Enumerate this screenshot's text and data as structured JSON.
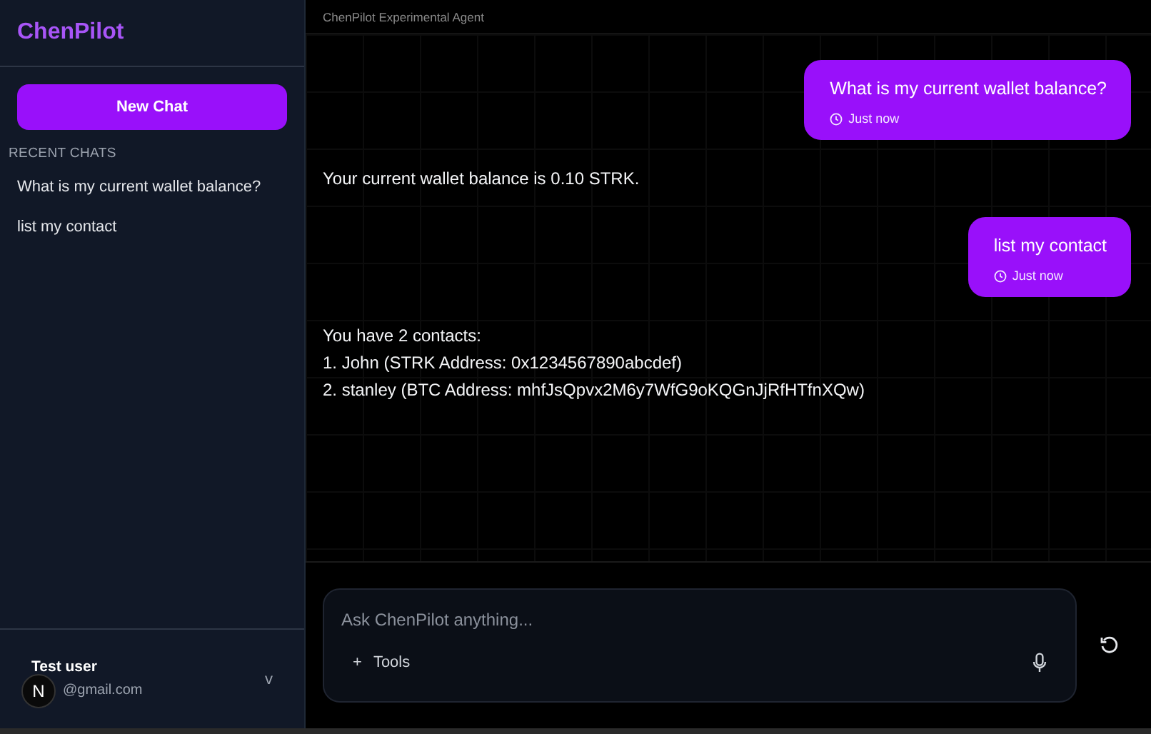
{
  "sidebar": {
    "brand": "ChenPilot",
    "new_chat_button": "New Chat",
    "recent_heading": "RECENT CHATS",
    "recent_chats": [
      {
        "title": "What is my current wallet balance?"
      },
      {
        "title": "list my contact"
      }
    ],
    "user": {
      "name": "Test user",
      "email": "@gmail.com",
      "menu_toggle": "v"
    },
    "floating_badge": "N"
  },
  "header": {
    "title": "ChenPilot Experimental Agent"
  },
  "messages": [
    {
      "kind": "user",
      "text": "What is my current wallet balance?",
      "time": "Just now"
    },
    {
      "kind": "assistant",
      "lines": [
        "Your current wallet balance is 0.10 STRK."
      ]
    },
    {
      "kind": "user",
      "text": "list my contact",
      "time": "Just now"
    },
    {
      "kind": "assistant",
      "lines": [
        "You have 2 contacts:",
        "1. John (STRK Address: 0x1234567890abcdef)",
        "2. stanley (BTC Address: mhfJsQpvx2M6y7WfG9oKQGnJjRfHTfnXQw)"
      ]
    }
  ],
  "composer": {
    "placeholder": "Ask ChenPilot anything...",
    "tools_button": {
      "icon": "+",
      "label": "Tools"
    }
  }
}
